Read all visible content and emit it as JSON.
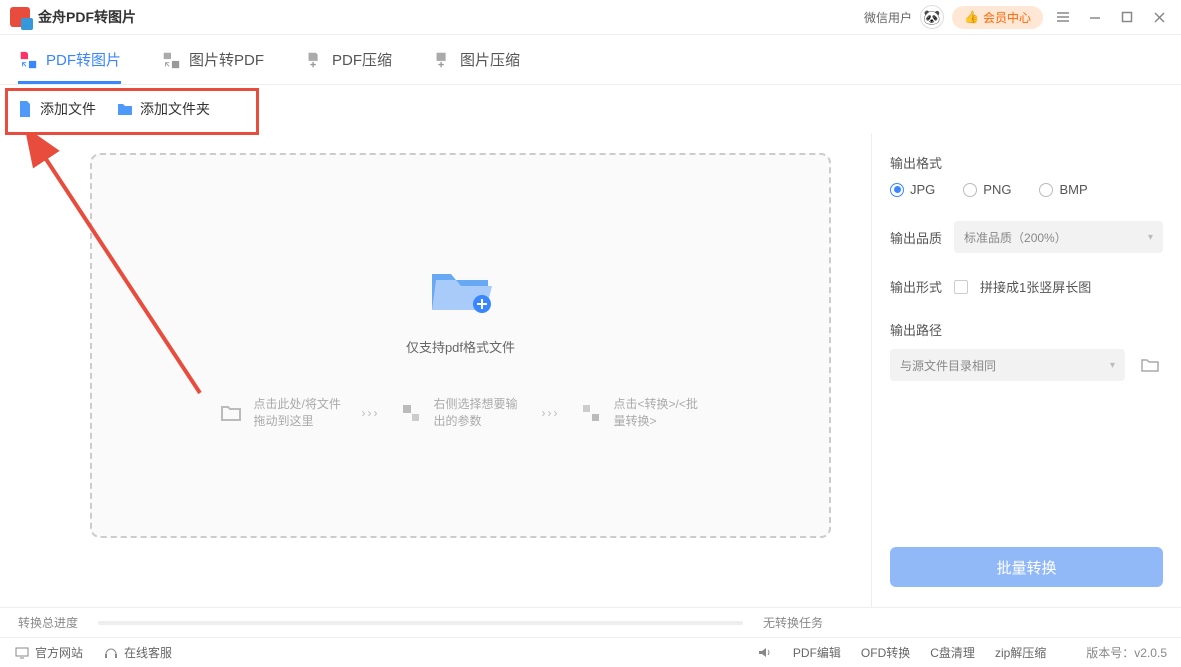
{
  "titlebar": {
    "title": "金舟PDF转图片",
    "wechat_user": "微信用户",
    "avatar_emoji": "🐼",
    "vip_label": "会员中心",
    "vip_icon": "👍"
  },
  "tabs": [
    {
      "label": "PDF转图片",
      "active": true
    },
    {
      "label": "图片转PDF",
      "active": false
    },
    {
      "label": "PDF压缩",
      "active": false
    },
    {
      "label": "图片压缩",
      "active": false
    }
  ],
  "add_buttons": {
    "add_file": "添加文件",
    "add_folder": "添加文件夹"
  },
  "dropzone": {
    "support_text": "仅支持pdf格式文件",
    "steps": [
      "点击此处/将文件拖动到这里",
      "右侧选择想要输出的参数",
      "点击<转换>/<批量转换>"
    ]
  },
  "right_panel": {
    "output_format_label": "输出格式",
    "formats": [
      "JPG",
      "PNG",
      "BMP"
    ],
    "selected_format": "JPG",
    "output_quality_label": "输出品质",
    "quality_value": "标准品质（200%）",
    "output_form_label": "输出形式",
    "stitch_label": "拼接成1张竖屏长图",
    "output_path_label": "输出路径",
    "path_value": "与源文件目录相同",
    "convert_button": "批量转换"
  },
  "progress": {
    "label": "转换总进度",
    "status": "无转换任务"
  },
  "footer": {
    "official_site": "官方网站",
    "online_service": "在线客服",
    "links": [
      "PDF编辑",
      "OFD转换",
      "C盘清理",
      "zip解压缩"
    ],
    "version_label": "版本号：",
    "version": "v2.0.5"
  }
}
